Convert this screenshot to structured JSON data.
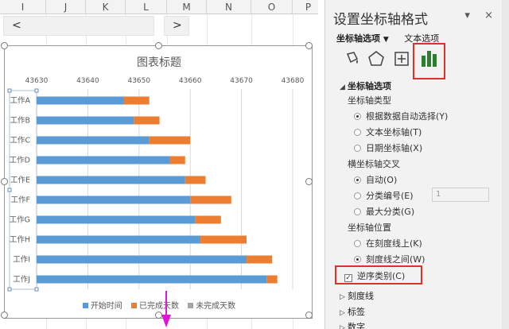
{
  "sheet": {
    "column_headers": [
      "I",
      "J",
      "K",
      "L",
      "M",
      "N",
      "O",
      "P"
    ],
    "scroll_left": "<",
    "scroll_right": ">"
  },
  "chart_data": {
    "type": "bar",
    "orientation": "horizontal-stacked",
    "title": "图表标题",
    "categories": [
      "工作A",
      "工作B",
      "工作C",
      "工作D",
      "工作E",
      "工作F",
      "工作G",
      "工作H",
      "工作I",
      "工作J"
    ],
    "series": [
      {
        "name": "开始时间",
        "color": "#5b9bd5",
        "values": [
          43647.0,
          43649.0,
          43652.0,
          43656.0,
          43659.0,
          43660.0,
          43661.0,
          43662.0,
          43671.0,
          43675.0
        ]
      },
      {
        "name": "已完成天数",
        "color": "#ed7d31",
        "values": [
          5,
          5,
          8,
          3,
          4,
          8,
          5,
          9,
          5,
          2
        ]
      },
      {
        "name": "未完成天数",
        "color": "#a5a5a5",
        "values": [
          0,
          0,
          0,
          0,
          0,
          0,
          0,
          0,
          0,
          0
        ]
      }
    ],
    "xlim": [
      43630,
      43680
    ],
    "xticks": [
      "43630",
      "43640",
      "43650",
      "43660",
      "43670",
      "43680"
    ],
    "legend_position": "bottom",
    "grid": true,
    "reverse_categories": true
  },
  "pane": {
    "title": "设置坐标轴格式",
    "close": "×",
    "dropdown": "▾",
    "tabs": [
      "坐标轴选项",
      "文本选项"
    ],
    "icons": [
      "fill-icon",
      "pentagon-icon",
      "size-properties-icon",
      "bar-chart-icon"
    ],
    "section_axis_options": "坐标轴选项",
    "axis_type_label": "坐标轴类型",
    "axis_type_options": [
      "根据数据自动选择(Y)",
      "文本坐标轴(T)",
      "日期坐标轴(X)"
    ],
    "axis_type_selected": 0,
    "cross_label": "横坐标轴交叉",
    "cross_options": [
      "自动(O)",
      "分类编号(E)",
      "最大分类(G)"
    ],
    "cross_selected": 0,
    "category_number_value": "1",
    "position_label": "坐标轴位置",
    "position_options": [
      "在刻度线上(K)",
      "刻度线之间(W)"
    ],
    "position_selected": 1,
    "reverse_label": "逆序类别(C)",
    "reverse_checked": "✓",
    "collapsed_sections": [
      "刻度线",
      "标签",
      "数字"
    ]
  },
  "colors": {
    "accent_red": "#d9342b",
    "blue": "#5b9bd5",
    "orange": "#ed7d31",
    "magenta": "#e014d6"
  }
}
